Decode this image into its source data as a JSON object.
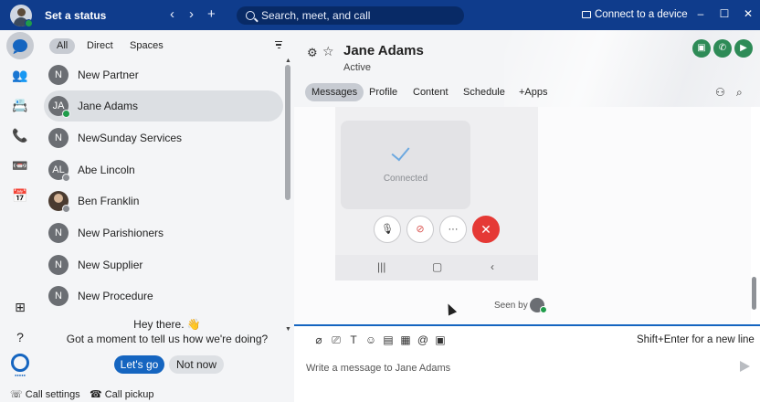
{
  "titlebar": {
    "status_label": "Set a status",
    "search_placeholder": "Search, meet, and call",
    "connect_label": "Connect to a device",
    "nav_back": "‹",
    "nav_forward": "›",
    "nav_add": "+",
    "win_min": "–",
    "win_max": "☐",
    "win_close": "✕"
  },
  "filters": {
    "all": "All",
    "direct": "Direct",
    "spaces": "Spaces"
  },
  "contacts": [
    {
      "initials": "N",
      "name": "New Partner",
      "badge": "none"
    },
    {
      "initials": "JA",
      "name": "Jane Adams",
      "badge": "green",
      "selected": true
    },
    {
      "initials": "N",
      "name": "NewSunday Services",
      "badge": "none"
    },
    {
      "initials": "AL",
      "name": "Abe Lincoln",
      "badge": "grey"
    },
    {
      "initials": "",
      "name": "Ben Franklin",
      "badge": "grey",
      "photo": true
    },
    {
      "initials": "N",
      "name": "New Parishioners",
      "badge": "none"
    },
    {
      "initials": "N",
      "name": "New Supplier",
      "badge": "none"
    },
    {
      "initials": "N",
      "name": "New Procedure",
      "badge": "none"
    }
  ],
  "survey": {
    "title": "Hey there. 👋",
    "question": "Got a moment to tell us how we're doing?",
    "primary": "Let's go",
    "secondary": "Not now"
  },
  "bottom": {
    "call_settings": "Call settings",
    "call_pickup": "Call pickup"
  },
  "conversation": {
    "title": "Jane Adams",
    "status": "Active",
    "tabs": [
      "Messages",
      "Profile",
      "Content",
      "Schedule",
      "+Apps"
    ],
    "connected_label": "Connected",
    "seen_by": "Seen by",
    "hint": "Shift+Enter for a new line",
    "compose_placeholder": "Write a message to Jane Adams"
  },
  "colors": {
    "brand": "#0f3c8c",
    "accent": "#1565c0",
    "presence": "#1f9c4a",
    "call_green": "#2e8b57",
    "end_call": "#e53935"
  }
}
